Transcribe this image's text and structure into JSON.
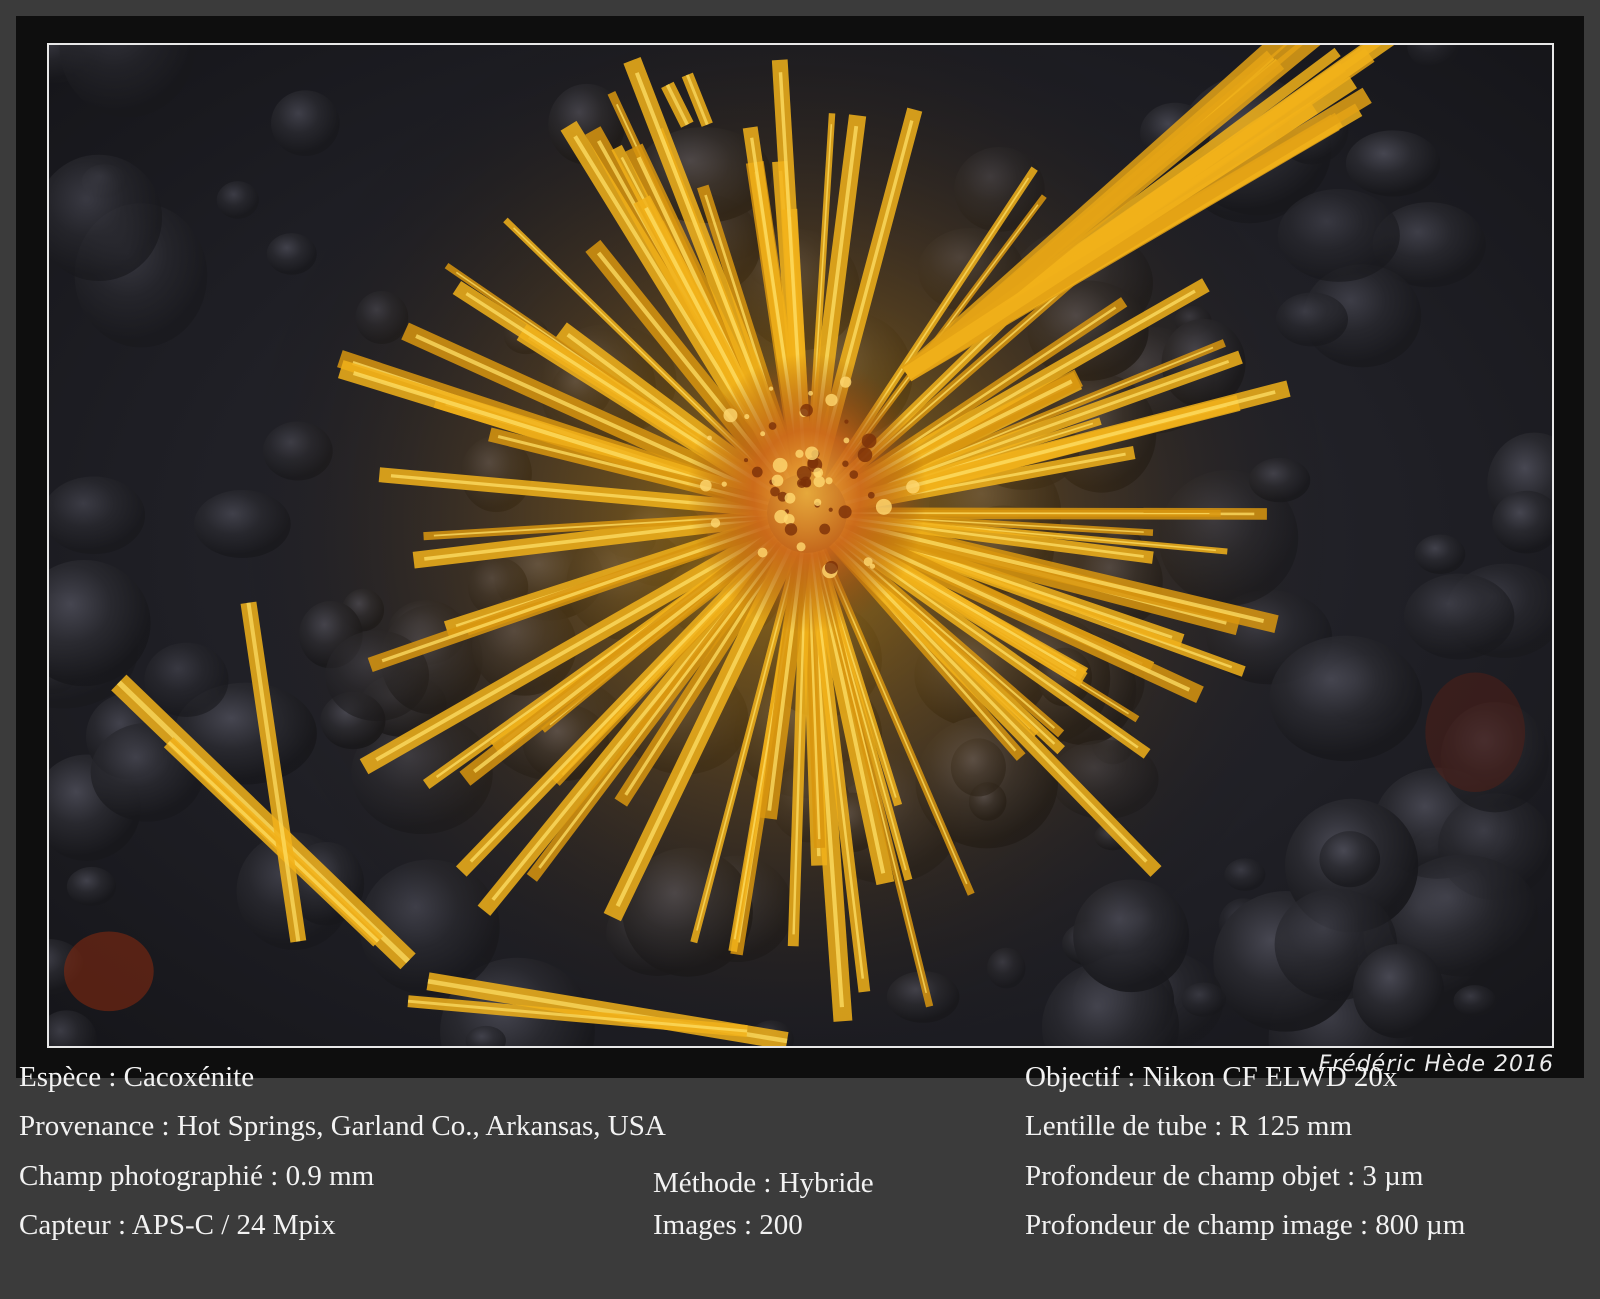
{
  "photo": {
    "subject": "Cacoxénite",
    "colors": {
      "crystal": "#f2b21a",
      "crystal_highlight": "#ffe066",
      "crystal_core": "#c8641a",
      "matrix": "#26262c",
      "frame": "#e8e8e8"
    }
  },
  "signature": "Frédéric Hède 2016",
  "left_column": [
    {
      "label": "Espèce",
      "value": "Cacoxénite"
    },
    {
      "label": "Provenance",
      "value": "Hot Springs, Garland Co., Arkansas, USA"
    },
    {
      "label": "Champ photographié",
      "value": "0.9 mm"
    },
    {
      "label": "Capteur",
      "value": "APS-C / 24 Mpix"
    }
  ],
  "middle_column": [
    {
      "label": "Méthode",
      "value": "Hybride"
    },
    {
      "label": "Images",
      "value": "200"
    }
  ],
  "right_column": [
    {
      "label": "Objectif",
      "value": "Nikon CF  ELWD 20x"
    },
    {
      "label": "Lentille de tube",
      "value": "R 125 mm"
    },
    {
      "label": "Profondeur de champ objet",
      "value": "3 µm"
    },
    {
      "label": "Profondeur de champ image",
      "value": "800 µm"
    }
  ]
}
